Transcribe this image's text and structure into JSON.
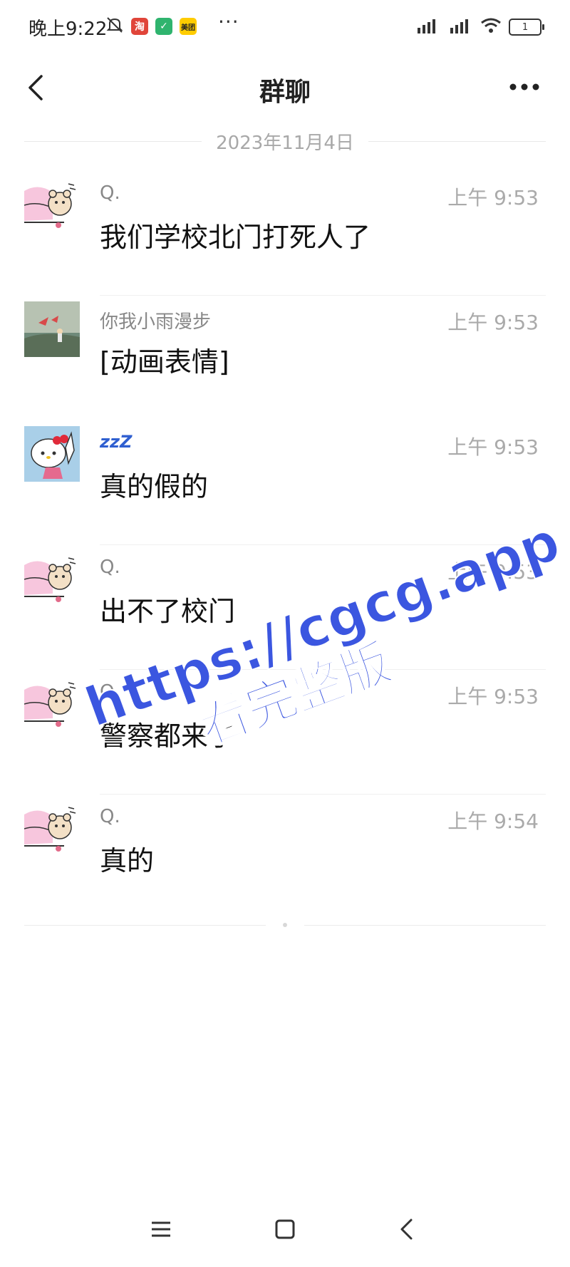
{
  "status_bar": {
    "time": "晚上9:22",
    "overflow": "···",
    "apps": [
      {
        "name": "taobao-icon",
        "text": "淘",
        "color": "#e0453a"
      },
      {
        "name": "security-icon",
        "text": "✓",
        "color": "#2fb46e"
      },
      {
        "name": "meituan-icon",
        "text": "美团",
        "color": "#ffcc00"
      }
    ],
    "battery": "1"
  },
  "header": {
    "title": "群聊"
  },
  "chat": {
    "date": "2023年11月4日",
    "messages": [
      {
        "sender": "Q.",
        "time": "上午 9:53",
        "text": "我们学校北门打死人了",
        "avatar": "bear-sticker"
      },
      {
        "sender": "你我小雨漫步",
        "time": "上午 9:53",
        "text": "[动画表情]",
        "avatar": "landscape"
      },
      {
        "sender": "zzZ",
        "time": "上午 9:53",
        "text": "真的假的",
        "avatar": "hello-kitty"
      },
      {
        "sender": "Q.",
        "time": "上午 9:53",
        "text": "出不了校门",
        "avatar": "bear-sticker"
      },
      {
        "sender": "Q.",
        "time": "上午 9:53",
        "text": "警察都来了",
        "avatar": "bear-sticker"
      },
      {
        "sender": "Q.",
        "time": "上午 9:54",
        "text": "真的",
        "avatar": "bear-sticker"
      }
    ]
  },
  "watermark": {
    "url": "https://cgcg.app",
    "text": "看完整版",
    "color": "#3b56e0"
  }
}
